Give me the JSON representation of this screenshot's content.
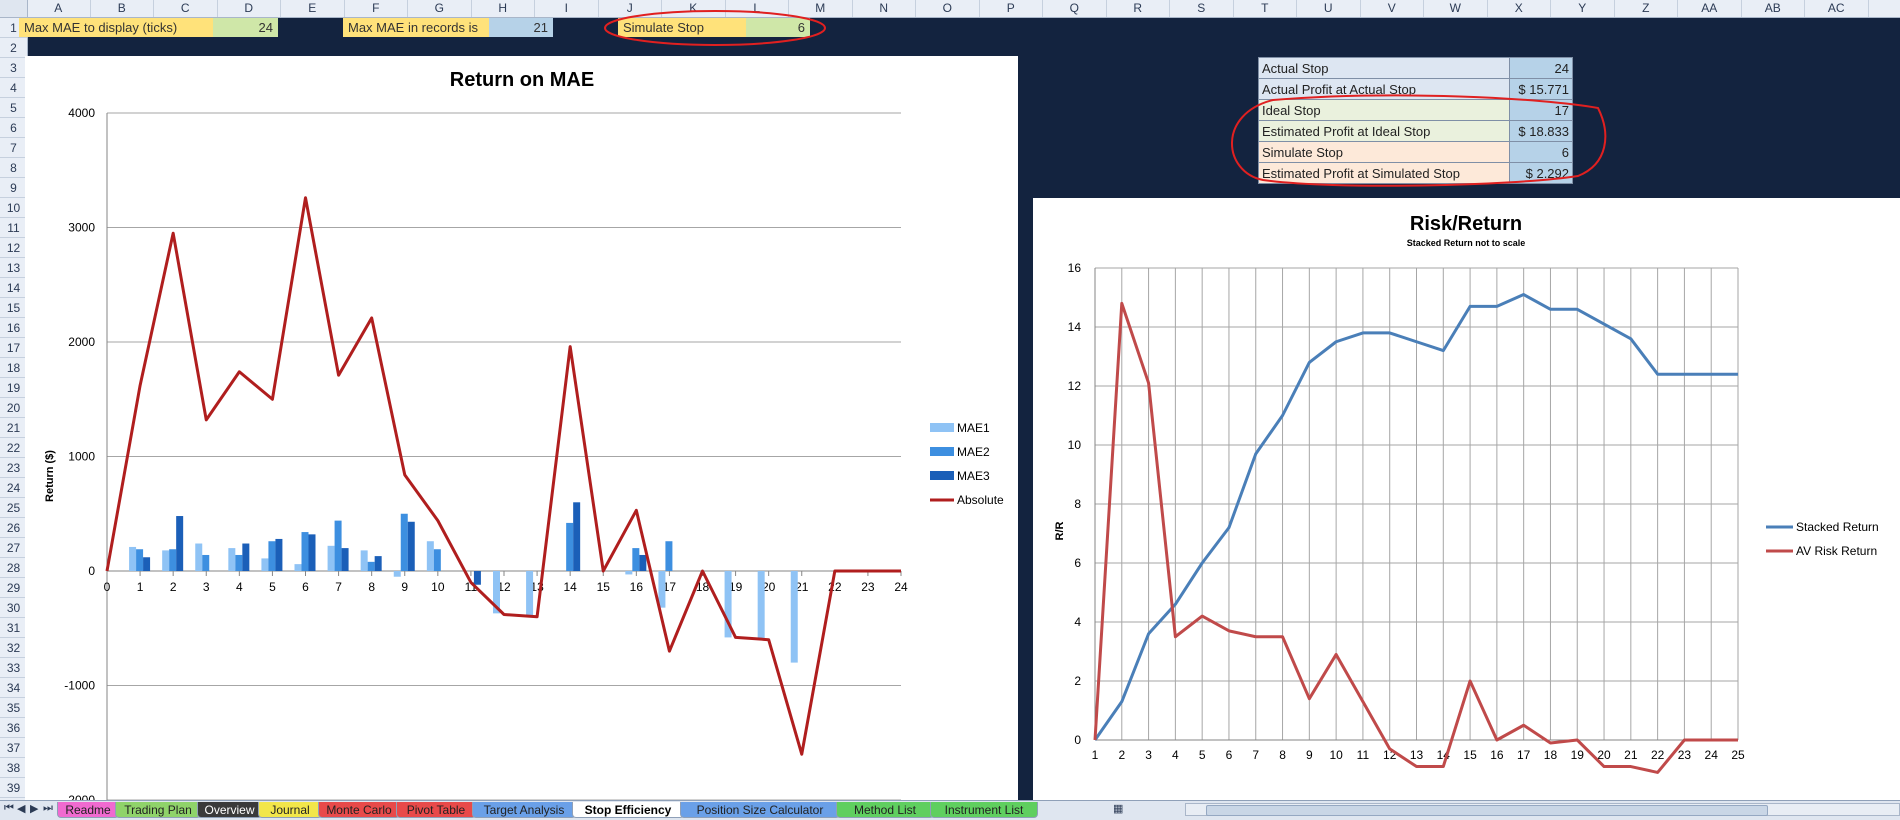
{
  "columns": [
    "A",
    "B",
    "C",
    "D",
    "E",
    "F",
    "G",
    "H",
    "I",
    "J",
    "K",
    "L",
    "M",
    "N",
    "O",
    "P",
    "Q",
    "R",
    "S",
    "T",
    "U",
    "V",
    "W",
    "X",
    "Y",
    "Z",
    "AA",
    "AB",
    "AC"
  ],
  "rows": [
    "1",
    "2",
    "3",
    "4",
    "5",
    "6",
    "7",
    "8",
    "9",
    "10",
    "11",
    "12",
    "13",
    "14",
    "15",
    "16",
    "17",
    "18",
    "19",
    "20",
    "21",
    "22",
    "23",
    "24",
    "25",
    "26",
    "27",
    "28",
    "29",
    "30",
    "31",
    "32",
    "33",
    "34",
    "35",
    "36",
    "37",
    "38",
    "39"
  ],
  "top_cells": {
    "max_mae_label": "Max MAE to display (ticks)",
    "max_mae_value": "24",
    "max_rec_label": "Max MAE in records is",
    "max_rec_value": "21",
    "sim_label": "Simulate Stop",
    "sim_value": "6"
  },
  "stats_table": [
    {
      "label": "Actual Stop",
      "value": "24",
      "color": "#dde6f2"
    },
    {
      "label": "Actual Profit at Actual Stop",
      "value": "$ 15.771",
      "color": "#dde6f2"
    },
    {
      "label": "Ideal Stop",
      "value": "17",
      "color": "#eaf1dd"
    },
    {
      "label": "Estimated Profit at Ideal Stop",
      "value": "$ 18.833",
      "color": "#eaf1dd"
    },
    {
      "label": "Simulate Stop",
      "value": "6",
      "color": "#fde9d9"
    },
    {
      "label": "Estimated Profit at Simulated Stop",
      "value": "$   2.292",
      "color": "#fde9d9"
    }
  ],
  "chart_data": [
    {
      "type": "bar",
      "title": "Return on MAE",
      "ylabel": "Return ($)",
      "ylim": [
        -2000,
        4000
      ],
      "yticks": [
        4000,
        3000,
        2000,
        1000,
        0,
        -1000,
        -2000
      ],
      "categories": [
        "0",
        "1",
        "2",
        "3",
        "4",
        "5",
        "6",
        "7",
        "8",
        "9",
        "10",
        "11",
        "12",
        "13",
        "14",
        "15",
        "16",
        "17",
        "18",
        "19",
        "20",
        "21",
        "22",
        "23",
        "24"
      ],
      "series": [
        {
          "name": "MAE1",
          "kind": "bar",
          "color": "#8fc3f5",
          "values": [
            0,
            210,
            180,
            240,
            200,
            110,
            60,
            220,
            180,
            -50,
            260,
            0,
            -370,
            -390,
            0,
            0,
            -30,
            -320,
            0,
            -580,
            -600,
            -800,
            0,
            0,
            0
          ]
        },
        {
          "name": "MAE2",
          "kind": "bar",
          "color": "#3d8fe0",
          "values": [
            0,
            190,
            190,
            140,
            140,
            260,
            340,
            440,
            80,
            500,
            190,
            0,
            0,
            0,
            420,
            0,
            200,
            260,
            0,
            0,
            0,
            0,
            0,
            0,
            0
          ]
        },
        {
          "name": "MAE3",
          "kind": "bar",
          "color": "#1b5fb8",
          "values": [
            0,
            120,
            480,
            0,
            240,
            280,
            320,
            200,
            130,
            430,
            0,
            -120,
            0,
            0,
            600,
            0,
            140,
            0,
            0,
            0,
            0,
            0,
            0,
            0,
            0
          ]
        },
        {
          "name": "Absolute",
          "kind": "line",
          "color": "#b01e1e",
          "values": [
            0,
            1620,
            2950,
            1320,
            1740,
            1500,
            3260,
            1710,
            2210,
            840,
            440,
            -100,
            -380,
            -400,
            1960,
            0,
            530,
            -700,
            0,
            -580,
            -600,
            -1600,
            0,
            0,
            0
          ]
        }
      ]
    },
    {
      "type": "line",
      "title": "Risk/Return",
      "subtitle": "Stacked Return not to scale",
      "ylabel": "R/R",
      "ylim": [
        0,
        16
      ],
      "yticks": [
        16,
        14,
        12,
        10,
        8,
        6,
        4,
        2,
        0
      ],
      "x": [
        "1",
        "2",
        "3",
        "4",
        "5",
        "6",
        "7",
        "8",
        "9",
        "10",
        "11",
        "12",
        "13",
        "14",
        "15",
        "16",
        "17",
        "18",
        "19",
        "20",
        "21",
        "22",
        "23",
        "24",
        "25"
      ],
      "series": [
        {
          "name": "Stacked Return",
          "color": "#4a7fb8",
          "values": [
            0,
            1.3,
            3.6,
            4.6,
            6,
            7.2,
            9.7,
            11,
            12.8,
            13.5,
            13.8,
            13.8,
            13.5,
            13.2,
            14.7,
            14.7,
            15.1,
            14.6,
            14.6,
            14.1,
            13.6,
            12.4,
            12.4,
            12.4,
            12.4
          ]
        },
        {
          "name": "AV Risk Return",
          "color": "#c04a4a",
          "values": [
            0,
            14.8,
            12.1,
            3.5,
            4.2,
            3.7,
            3.5,
            3.5,
            1.4,
            2.9,
            1.3,
            -0.3,
            -0.9,
            -0.9,
            2,
            0,
            0.5,
            -0.1,
            0,
            -0.9,
            -0.9,
            -1.1,
            0,
            0,
            0
          ]
        }
      ]
    }
  ],
  "sheet_tabs": [
    {
      "label": "Readme",
      "color": "#f06ad0"
    },
    {
      "label": "Trading Plan",
      "color": "#8fd36a"
    },
    {
      "label": "Overview",
      "color": "#3a3a3a"
    },
    {
      "label": "Journal",
      "color": "#f2e64a"
    },
    {
      "label": "Monte Carlo",
      "color": "#e84a4a"
    },
    {
      "label": "Pivot Table",
      "color": "#e84a4a"
    },
    {
      "label": "Target Analysis",
      "color": "#6aa0e8"
    },
    {
      "label": "Stop Efficiency",
      "color": "#ffffff"
    },
    {
      "label": "Position Size Calculator",
      "color": "#6aa0e8"
    },
    {
      "label": "Method List",
      "color": "#5fcf5f"
    },
    {
      "label": "Instrument List",
      "color": "#5fcf5f"
    }
  ]
}
